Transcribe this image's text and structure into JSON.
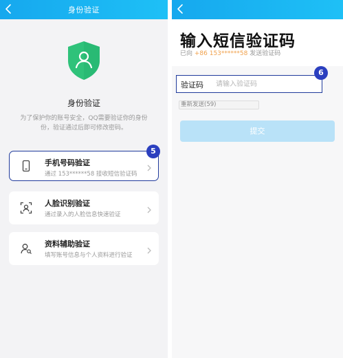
{
  "left_screen": {
    "header": {
      "title": "身份验证"
    },
    "heading": "身份验证",
    "description_line1": "为了保护你的账号安全，QQ需要验证你的身份",
    "description_line2": "份，验证通过后即可修改密码。",
    "options": [
      {
        "title": "手机号码验证",
        "subtitle": "通过 153******58 接收短信验证码",
        "icon": "phone-icon"
      },
      {
        "title": "人脸识别验证",
        "subtitle": "通过录入的人脸信息快速验证",
        "icon": "face-scan-icon"
      },
      {
        "title": "资料辅助验证",
        "subtitle": "填写账号信息与个人资料进行验证",
        "icon": "person-search-icon"
      }
    ],
    "step_badge": "5"
  },
  "right_screen": {
    "title": "输入短信验证码",
    "sent_prefix": "已向 ",
    "sent_phone": "+86 153******58",
    "sent_suffix": " 发送验证码",
    "code_field": {
      "label": "验证码",
      "placeholder": "请输入验证码",
      "value": ""
    },
    "resend_label": "重新发送(59)",
    "submit_label": "提交",
    "step_badge": "6"
  },
  "colors": {
    "header_blue": "#16a8ee",
    "shield_green": "#2fc27a",
    "phone_orange": "#f0a04b",
    "badge_navy": "#2b3fbf",
    "submit_disabled": "#b9e2f8"
  }
}
